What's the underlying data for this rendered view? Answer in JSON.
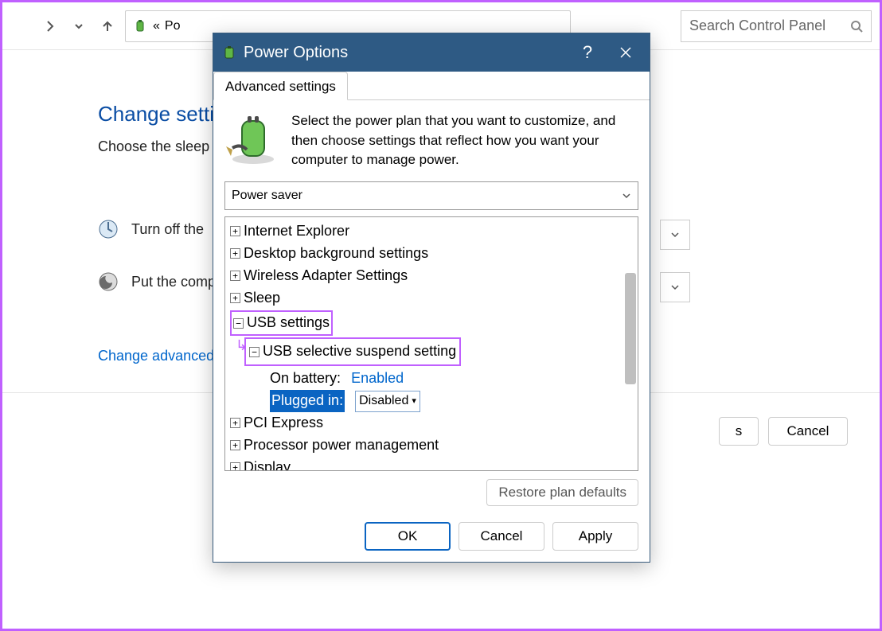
{
  "toolbar": {
    "breadcrumb_prefix": "«",
    "breadcrumb_text": "Po",
    "search_placeholder": "Search Control Panel"
  },
  "background": {
    "heading": "Change setti",
    "subtitle": "Choose the sleep",
    "row1_label": "Turn off the ",
    "row2_label": "Put the comp",
    "link_advanced": "Change advanced",
    "btn_s": "s",
    "btn_cancel": "Cancel"
  },
  "dialog": {
    "title": "Power Options",
    "help": "?",
    "tab_label": "Advanced settings",
    "intro": "Select the power plan that you want to customize, and then choose settings that reflect how you want your computer to manage power.",
    "plan_selected": "Power saver",
    "tree": {
      "items": [
        {
          "label": "Internet Explorer",
          "exp": "+"
        },
        {
          "label": "Desktop background settings",
          "exp": "+"
        },
        {
          "label": "Wireless Adapter Settings",
          "exp": "+"
        },
        {
          "label": "Sleep",
          "exp": "+"
        },
        {
          "label": "USB settings",
          "exp": "−"
        },
        {
          "label": "USB selective suspend setting",
          "exp": "−"
        },
        {
          "label_a": "On battery:",
          "value_a": "Enabled"
        },
        {
          "label_b": "Plugged in:",
          "value_b": "Disabled"
        },
        {
          "label": "PCI Express",
          "exp": "+"
        },
        {
          "label": "Processor power management",
          "exp": "+"
        },
        {
          "label": "Display",
          "exp": "+"
        }
      ]
    },
    "restore": "Restore plan defaults",
    "btn_ok": "OK",
    "btn_cancel": "Cancel",
    "btn_apply": "Apply"
  }
}
